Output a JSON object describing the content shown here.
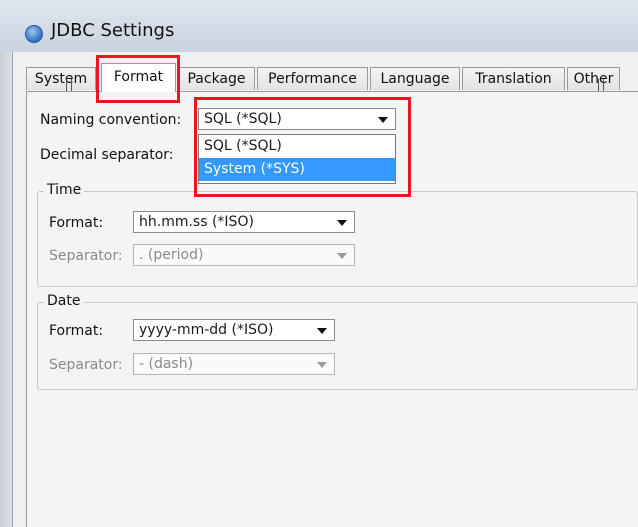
{
  "window": {
    "title": "JDBC Settings",
    "icon": "app-globe-icon"
  },
  "tabs": [
    {
      "label": "System"
    },
    {
      "label": "Format",
      "active": true
    },
    {
      "label": "Package"
    },
    {
      "label": "Performance"
    },
    {
      "label": "Language"
    },
    {
      "label": "Translation"
    },
    {
      "label": "Other"
    }
  ],
  "format": {
    "naming_label": "Naming convention:",
    "naming_value": "SQL (*SQL)",
    "naming_options": [
      "SQL (*SQL)",
      "System (*SYS)"
    ],
    "decimal_label": "Decimal separator:",
    "time": {
      "title": "Time",
      "format_label": "Format:",
      "format_value": "hh.mm.ss (*ISO)",
      "separator_label": "Separator:",
      "separator_value": ". (period)"
    },
    "date": {
      "title": "Date",
      "format_label": "Format:",
      "format_value": "yyyy-mm-dd (*ISO)",
      "separator_label": "Separator:",
      "separator_value": "- (dash)"
    }
  },
  "colors": {
    "highlight": "#e8171f",
    "selection": "#3399ff"
  }
}
